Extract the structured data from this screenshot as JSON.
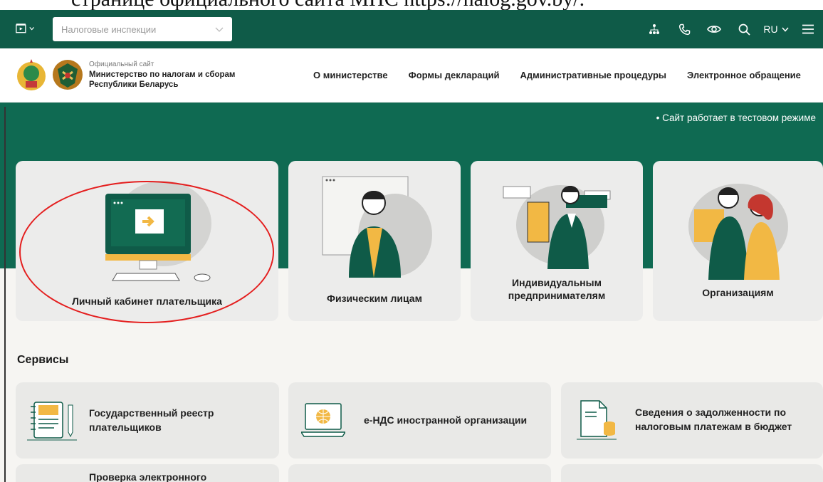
{
  "caption": "странице официального сайта МНС https://nalog.gov.by/.",
  "topbar": {
    "select_value": "Налоговые инспекции",
    "lang": "RU",
    "icons": [
      "app-switcher-icon",
      "sitemap-icon",
      "phone-icon",
      "eye-icon",
      "search-icon",
      "menu-icon"
    ]
  },
  "header": {
    "site_tag": "Официальный сайт",
    "org_line1": "Министерство по налогам и сборам",
    "org_line2": "Республики Беларусь",
    "nav": [
      "О министерстве",
      "Формы деклараций",
      "Административные процедуры",
      "Электронное обращение"
    ]
  },
  "ticker": "• Сайт работает в тестовом режиме",
  "cards": [
    {
      "label": "Личный кабинет плательщика"
    },
    {
      "label": "Физическим лицам"
    },
    {
      "label_line1": "Индивидуальным",
      "label_line2": "предпринимателям"
    },
    {
      "label": "Организациям"
    }
  ],
  "services": {
    "title": "Сервисы",
    "items": [
      {
        "line1": "Государственный реестр",
        "line2": "плательщиков"
      },
      {
        "line1": "е-НДС иностранной организации"
      },
      {
        "line1": "Сведения о задолженности по",
        "line2": "налоговым платежам в бюджет"
      },
      {
        "line1": "Проверка электронного"
      }
    ]
  },
  "colors": {
    "brand_green": "#0f6a52",
    "accent_yellow": "#f2b844",
    "highlight_red": "#e41e1e"
  }
}
